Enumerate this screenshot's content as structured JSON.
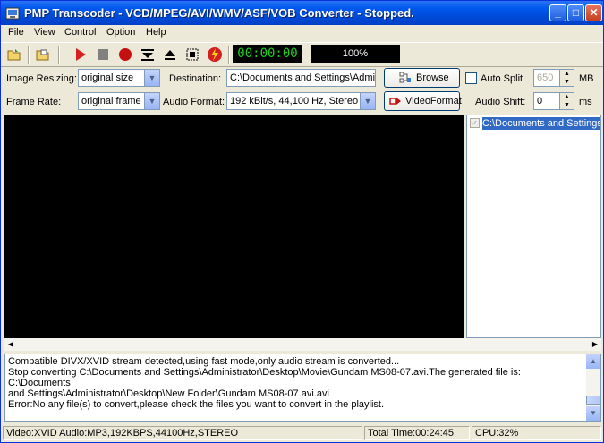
{
  "window": {
    "title": "PMP Transcoder - VCD/MPEG/AVI/WMV/ASF/VOB Converter - Stopped.",
    "controls": {
      "minimize": "_",
      "maximize": "□",
      "close": "✕"
    }
  },
  "menu": [
    "File",
    "View",
    "Control",
    "Option",
    "Help"
  ],
  "toolbar": {
    "icons": [
      "open-folder-icon",
      "open-file-icon",
      "play-icon",
      "stop-icon",
      "record-icon",
      "eject-down-icon",
      "eject-up-icon",
      "settings-icon",
      "flash-icon"
    ],
    "timer": "00:00:00",
    "progress": "100%",
    "progress_value": 100
  },
  "row1": {
    "image_resizing_label": "Image Resizing:",
    "image_resizing_value": "original size",
    "destination_label": "Destination:",
    "destination_value": "C:\\Documents and Settings\\Admir",
    "browse_label": "Browse",
    "auto_split_label": "Auto Split",
    "split_value": "650",
    "split_unit": "MB"
  },
  "row2": {
    "frame_rate_label": "Frame Rate:",
    "frame_rate_value": "original frame ra",
    "audio_format_label": "Audio Format:",
    "audio_format_value": "192 kBit/s, 44,100 Hz, Stereo",
    "video_format_label": "VideoFormat",
    "audio_shift_label": "Audio Shift:",
    "audio_shift_value": "0",
    "audio_shift_unit": "ms"
  },
  "playlist": {
    "items": [
      "C:\\Documents and Settings"
    ]
  },
  "log": {
    "lines": [
      "Compatible DIVX/XVID stream detected,using fast mode,only audio stream is converted...",
      "Stop converting C:\\Documents and Settings\\Administrator\\Desktop\\Movie\\Gundam MS08-07.avi.The generated file is: C:\\Documents",
      "and Settings\\Administrator\\Desktop\\New Folder\\Gundam MS08-07.avi.avi",
      "Error:No any file(s) to convert,please check the files you want to convert in the playlist."
    ]
  },
  "status": {
    "stream_info": "Video:XVID Audio:MP3,192KBPS,44100Hz,STEREO",
    "total_time": "Total Time:00:24:45",
    "cpu": "CPU:32%"
  },
  "colors": {
    "title_blue": "#0058ee",
    "timer_green": "#1fd11f",
    "selection": "#316ac5",
    "play_red": "#d42020"
  }
}
